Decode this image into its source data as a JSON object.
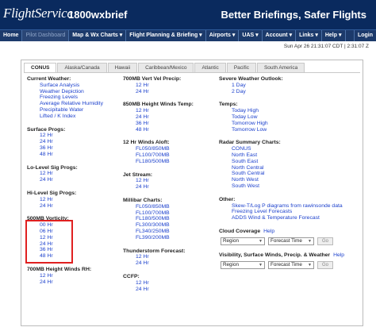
{
  "header": {
    "logo_text": "FlightService",
    "logo_small": "",
    "brand": "1800wxbrief",
    "tagline": "Better Briefings, Safer Flights"
  },
  "nav": {
    "items": [
      {
        "label": "Home"
      },
      {
        "label": "Pilot Dashboard"
      },
      {
        "label": "Map & Wx Charts ▾"
      },
      {
        "label": "Flight Planning & Briefing ▾"
      },
      {
        "label": "Airports ▾"
      },
      {
        "label": "UAS ▾"
      },
      {
        "label": "Account ▾"
      },
      {
        "label": "Links ▾"
      },
      {
        "label": "Help ▾"
      },
      {
        "label": "Login"
      }
    ]
  },
  "date": "Sun Apr 26 21:31:07 CDT | 2:31:07 Z",
  "tabs": [
    "CONUS",
    "Alaska/Canada",
    "Hawaii",
    "Caribbean/Mexico",
    "Atlantic",
    "Pacific",
    "South America"
  ],
  "col1": [
    {
      "heading": "Current Weather:",
      "links": [
        "Surface Analysis",
        "Weather Depiction",
        "Freezing Levels",
        "Average Relative Humidity",
        "Precipitable Water",
        "Lifted / K Index"
      ]
    },
    {
      "heading": "Surface Progs:",
      "links": [
        "12 Hr",
        "24 Hr",
        "36 Hr",
        "48 Hr"
      ]
    },
    {
      "heading": "Lo-Level Sig Progs:",
      "links": [
        "12 Hr",
        "24 Hr"
      ]
    },
    {
      "heading": "Hi-Level Sig Progs:",
      "links": [
        "12 Hr",
        "24 Hr"
      ]
    },
    {
      "heading": "500MB Vorticity:",
      "links": [
        "00 Hr",
        "06 Hr",
        "12 Hr",
        "24 Hr",
        "36 Hr",
        "48 Hr"
      ]
    },
    {
      "heading": "700MB Height Winds RH:",
      "links": [
        "12 Hr",
        "24 Hr"
      ]
    }
  ],
  "col2": [
    {
      "heading": "700MB Vert Vel Precip:",
      "links": [
        "12 Hr",
        "24 Hr"
      ]
    },
    {
      "heading": "850MB Height Winds Temp:",
      "links": [
        "12 Hr",
        "24 Hr",
        "36 Hr",
        "48 Hr"
      ]
    },
    {
      "heading": "12 Hr Winds Aloft:",
      "links": [
        "FL050/850MB",
        "FL100/700MB",
        "FL180/500MB"
      ]
    },
    {
      "heading": "Jet Stream:",
      "links": [
        "12 Hr",
        "24 Hr"
      ]
    },
    {
      "heading": "Millibar Charts:",
      "links": [
        "FL050/850MB",
        "FL100/700MB",
        "FL180/500MB",
        "FL300/300MB",
        "FL340/250MB",
        "FL390/200MB"
      ]
    },
    {
      "heading": "Thunderstorm Forecast:",
      "links": [
        "12 Hr",
        "24 Hr"
      ]
    },
    {
      "heading": "CCFP:",
      "links": [
        "12 Hr",
        "24 Hr"
      ]
    }
  ],
  "col3": [
    {
      "heading": "Severe Weather Outlook:",
      "links": [
        "1 Day",
        "2 Day"
      ]
    },
    {
      "heading": "Temps:",
      "links": [
        "Today High",
        "Today Low",
        "Tomorrow High",
        "Tomorrow Low"
      ]
    },
    {
      "heading": "Radar Summary Charts:",
      "links": [
        "CONUS",
        "North East",
        "South East",
        "North Central",
        "South Central",
        "North West",
        "South West"
      ]
    },
    {
      "heading": "Other:",
      "links": [
        "Skew-T/Log P diagrams from rawinsonde data",
        "Freezing Level Forecasts",
        "ADDS Wind & Temperature Forecast"
      ]
    }
  ],
  "cloud": {
    "heading": "Cloud Coverage",
    "help": "Help",
    "region": "Region",
    "forecast": "Forecast Time",
    "go": "Go"
  },
  "visibility": {
    "heading": "Visibility, Surface Winds, Precip. & Weather",
    "help": "Help",
    "region": "Region",
    "forecast": "Forecast Time",
    "go": "Go"
  }
}
